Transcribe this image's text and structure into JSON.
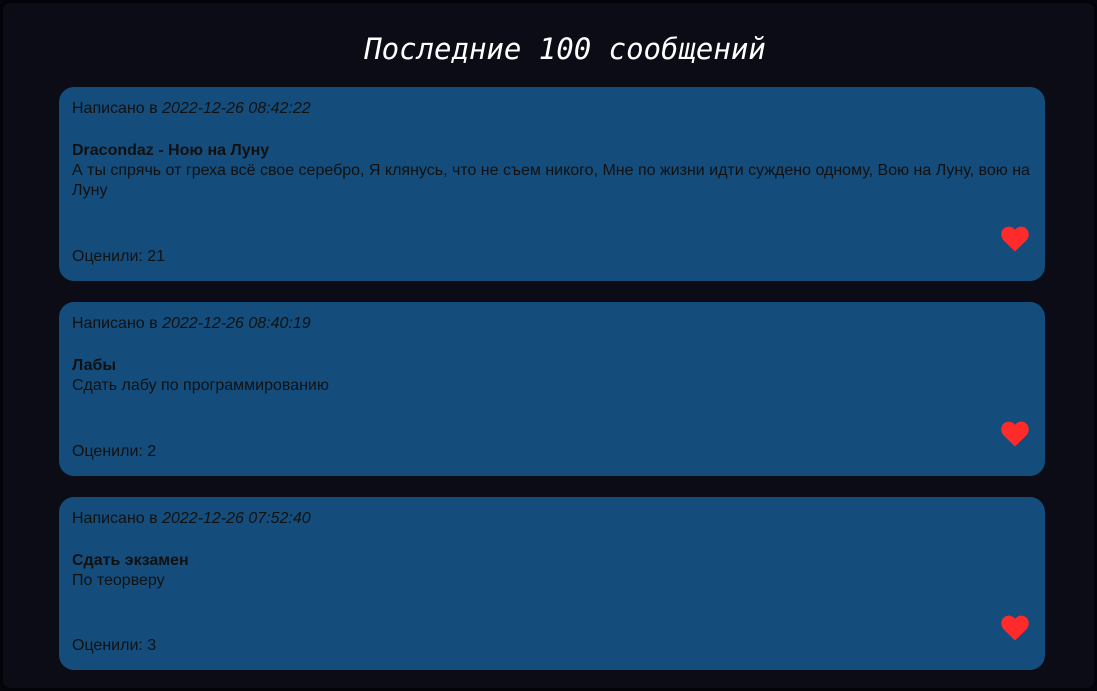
{
  "page": {
    "title": "Последние 100 сообщений"
  },
  "theme": {
    "background": "#0b0c15",
    "card": "#144d7c",
    "heart": "#ff2a2a",
    "title_text": "#ffffff",
    "card_text": "#111111"
  },
  "messages": [
    {
      "written_prefix": "Написано в",
      "timestamp": "2022-12-26 08:42:22",
      "subject": "Dracondaz - Ною на Луну",
      "body": "А ты спрячь от греха всё свое серебро, Я клянусь, что не съем никого, Мне по жизни идти суждено одному, Вою на Луну, вою на Луну",
      "rating_label": "Оценили: 21",
      "like_icon": "heart-icon"
    },
    {
      "written_prefix": "Написано в",
      "timestamp": "2022-12-26 08:40:19",
      "subject": "Лабы",
      "body": "Сдать лабу по программированию",
      "rating_label": "Оценили: 2",
      "like_icon": "heart-icon"
    },
    {
      "written_prefix": "Написано в",
      "timestamp": "2022-12-26 07:52:40",
      "subject": "Сдать экзамен",
      "body": "По теорверу",
      "rating_label": "Оценили: 3",
      "like_icon": "heart-icon"
    }
  ]
}
